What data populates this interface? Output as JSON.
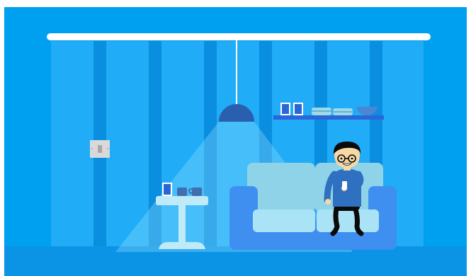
{
  "scene": {
    "description_name": "",
    "colors": {
      "background": "#00a0f0",
      "room_wall": "#0d9df0",
      "stripe_light": "#20acf6",
      "stripe_dark": "#0a8ee0",
      "floor": "#0b94e6",
      "rail": "#ffffff",
      "lamp_shade": "#2a5fb0",
      "light_beam": "#8fe0ff",
      "sofa_back": "#8ed3e8",
      "sofa_frame": "#3f8ff0",
      "sofa_cushion": "#a9e3f5",
      "table": "#bfeaf8",
      "shelf": "#2a66d8",
      "switch_plate": "#d9d9d9",
      "person_shirt": "#3070c0",
      "person_skin": "#f6d8a6",
      "person_hair": "#0a0a0a"
    },
    "icons": [
      "ceiling-rail",
      "pendant-lamp-icon",
      "wall-shelf-icon",
      "picture-frame-icon",
      "book-stack-icon",
      "bowl-icon",
      "light-switch-icon",
      "side-table-icon",
      "mug-icon",
      "sofa-icon",
      "person-icon",
      "phone-icon"
    ]
  }
}
